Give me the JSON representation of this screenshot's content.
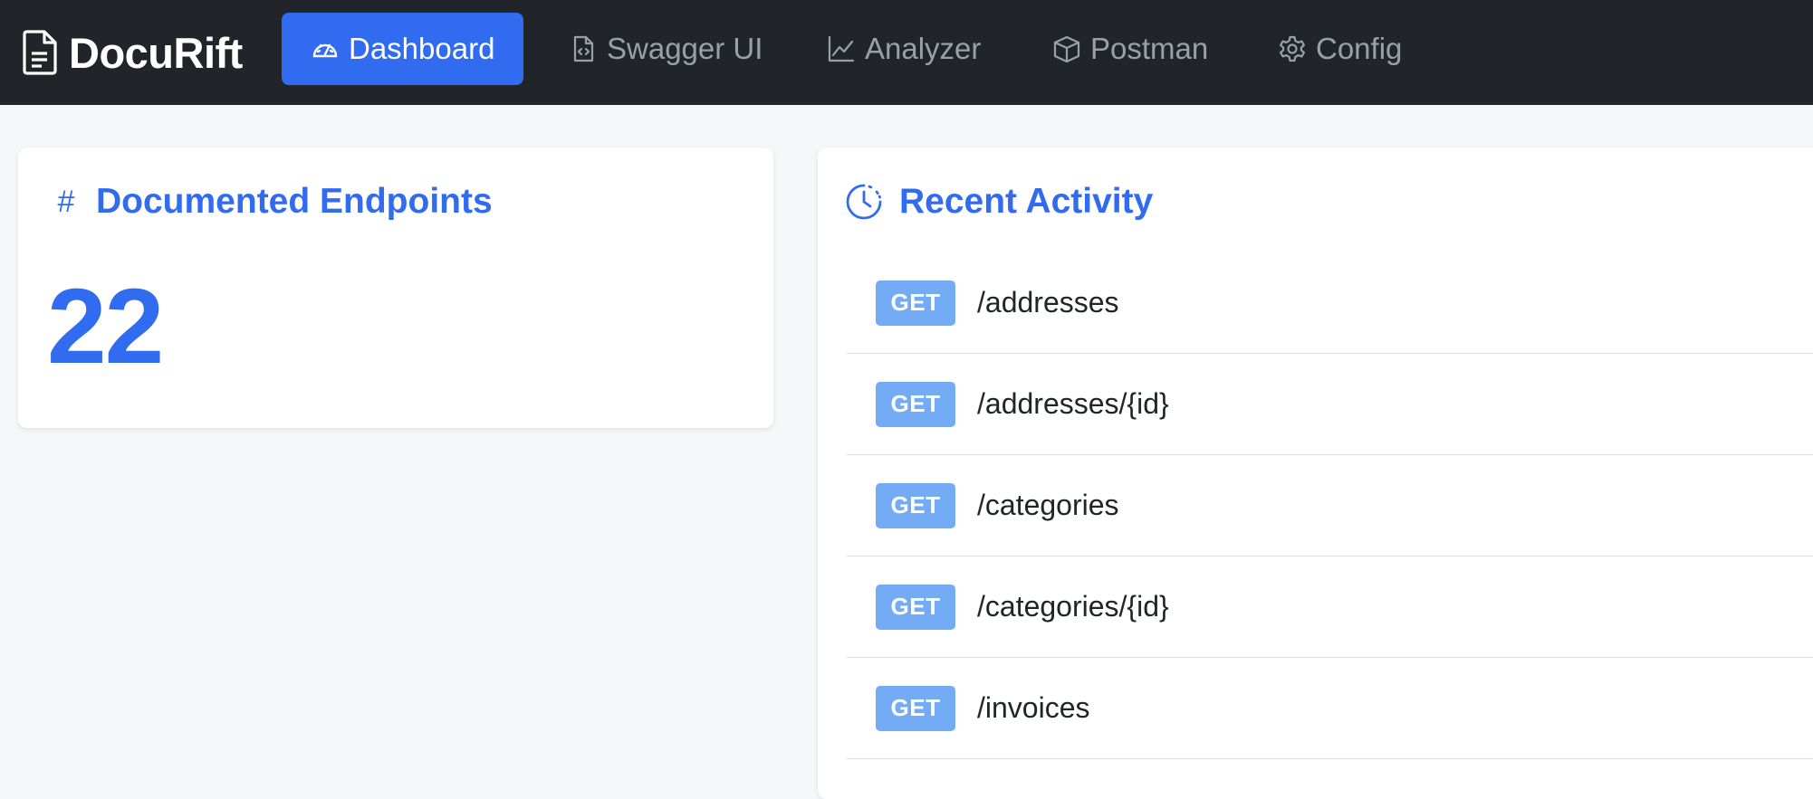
{
  "colors": {
    "accent": "#316bf0",
    "navbar_bg": "#212529",
    "badge_get": "#74abf5",
    "page_bg": "#f6f7f9"
  },
  "navbar": {
    "brand": {
      "icon": "document-icon",
      "label": "DocuRift"
    },
    "links": [
      {
        "label": "Dashboard",
        "icon": "speedometer-icon",
        "active": true
      },
      {
        "label": "Swagger UI",
        "icon": "code-file-icon",
        "active": false
      },
      {
        "label": "Analyzer",
        "icon": "line-chart-icon",
        "active": false
      },
      {
        "label": "Postman",
        "icon": "box-icon",
        "active": false
      },
      {
        "label": "Config",
        "icon": "gear-icon",
        "active": false
      }
    ]
  },
  "endpoints_card": {
    "icon": "hash-icon",
    "title": "Documented Endpoints",
    "count": "22"
  },
  "activity_card": {
    "icon": "clock-icon",
    "title": "Recent Activity",
    "items": [
      {
        "method": "GET",
        "path": "/addresses"
      },
      {
        "method": "GET",
        "path": "/addresses/{id}"
      },
      {
        "method": "GET",
        "path": "/categories"
      },
      {
        "method": "GET",
        "path": "/categories/{id}"
      },
      {
        "method": "GET",
        "path": "/invoices"
      }
    ]
  }
}
